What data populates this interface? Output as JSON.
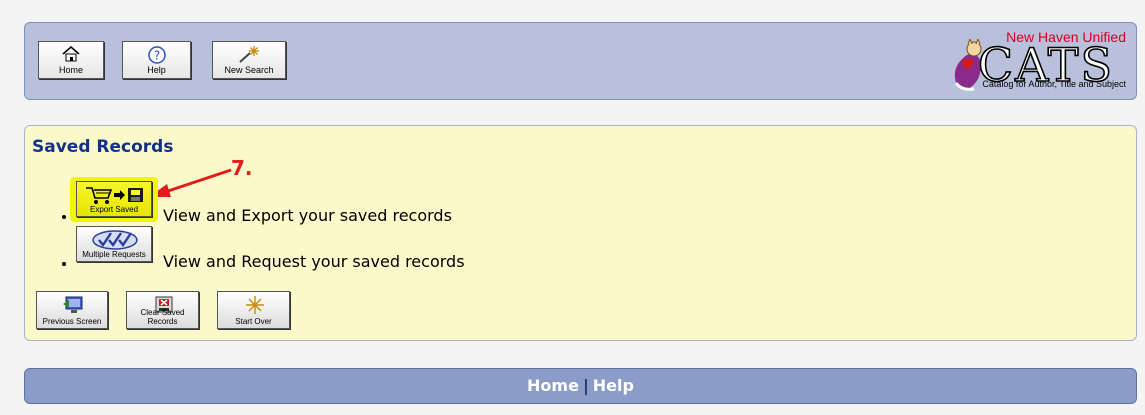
{
  "toolbar": {
    "home_label": "Home",
    "help_label": "Help",
    "new_search_label": "New Search"
  },
  "logo": {
    "organization": "New Haven Unified",
    "name": "CATS",
    "subtitle": "Catalog for Author, Title and Subject"
  },
  "saved": {
    "title": "Saved Records",
    "annotation": "7.",
    "options": [
      {
        "button_label": "Export Saved",
        "text": "View and Export your saved records"
      },
      {
        "button_label": "Multiple Requests",
        "text": "View and Request your saved records"
      }
    ],
    "actions": {
      "previous_label": "Previous Screen",
      "clear_label": "Clear Saved Records",
      "start_over_label": "Start Over"
    }
  },
  "footer": {
    "home": "Home",
    "separator": "|",
    "help": "Help"
  },
  "colors": {
    "header_bg": "#b8c0dc",
    "content_bg": "#fbf9c9",
    "title": "#11318a",
    "highlight": "#f3f40c",
    "annotation": "#e41b1b",
    "footer_bg": "#8c9cc8"
  }
}
